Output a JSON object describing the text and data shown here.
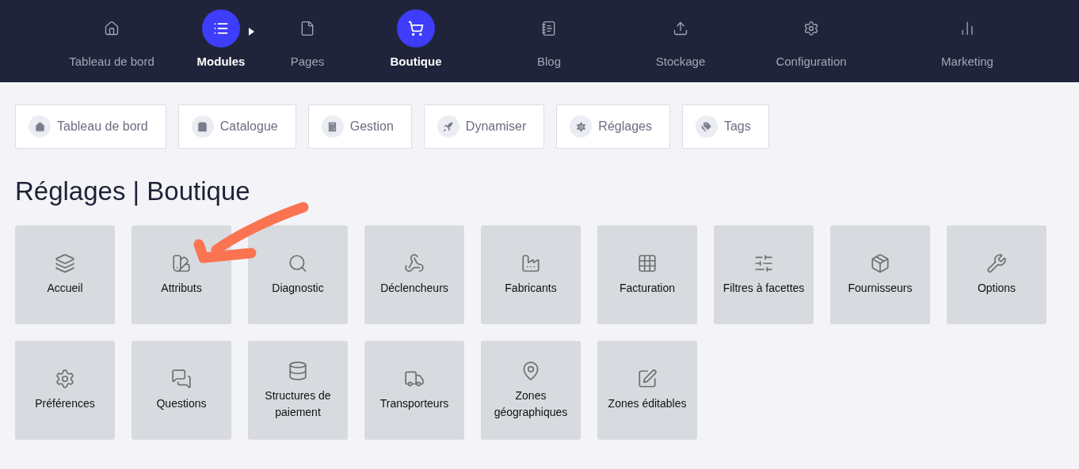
{
  "top_nav": [
    {
      "label": "Tableau de bord",
      "selected": false
    },
    {
      "label": "Modules",
      "selected": true
    },
    {
      "label": "Pages",
      "selected": false
    },
    {
      "label": "Boutique",
      "selected": true
    },
    {
      "label": "Blog",
      "selected": false
    },
    {
      "label": "Stockage",
      "selected": false
    },
    {
      "label": "Configuration",
      "selected": false
    },
    {
      "label": "Marketing",
      "selected": false
    }
  ],
  "sub_nav": [
    "Tableau de bord",
    "Catalogue",
    "Gestion",
    "Dynamiser",
    "Réglages",
    "Tags"
  ],
  "title": "Réglages | Boutique",
  "tiles": [
    [
      "Accueil",
      "Attributs",
      "Diagnostic",
      "Déclencheurs",
      "Fabricants",
      "Facturation",
      "Filtres à facettes",
      "Fournisseurs",
      "Options"
    ],
    [
      "Préférences",
      "Questions",
      "Structures de paiement",
      "Transporteurs",
      "Zones géographiques",
      "Zones éditables"
    ]
  ]
}
